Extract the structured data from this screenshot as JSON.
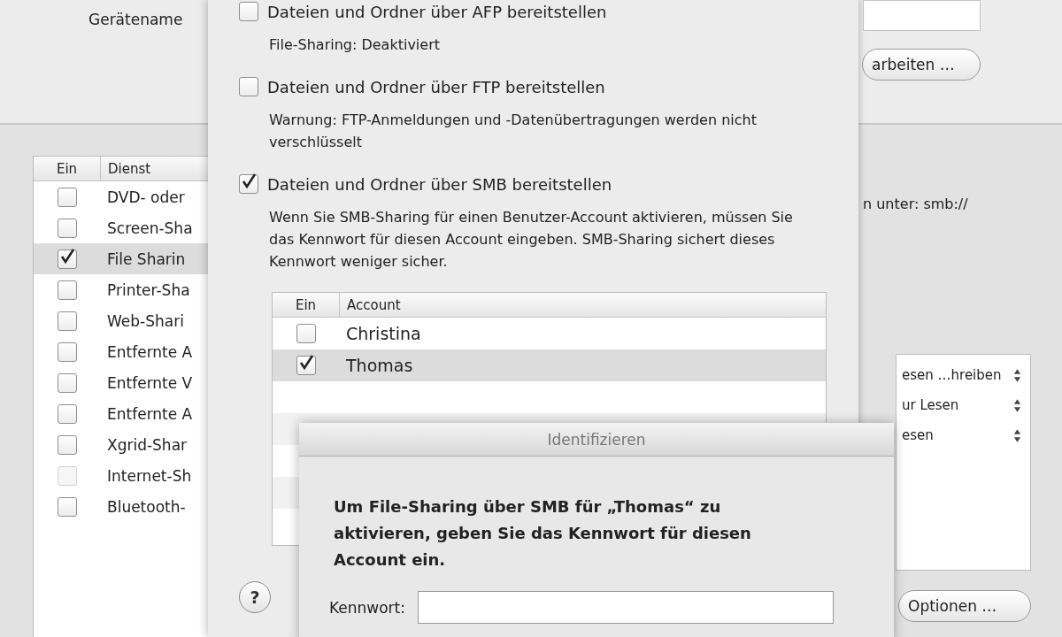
{
  "window": {
    "device_name_label": "Gerätename",
    "edit_button": "arbeiten …",
    "address_text": "n unter: smb://",
    "services": {
      "columns": [
        "Ein",
        "Dienst"
      ],
      "rows": [
        {
          "name": "DVD- oder",
          "checked": false,
          "disabled": false,
          "selected": false
        },
        {
          "name": "Screen-Sha",
          "checked": false,
          "disabled": false,
          "selected": false
        },
        {
          "name": "File Sharin",
          "checked": true,
          "disabled": false,
          "selected": true
        },
        {
          "name": "Printer-Sha",
          "checked": false,
          "disabled": false,
          "selected": false
        },
        {
          "name": "Web-Shari",
          "checked": false,
          "disabled": false,
          "selected": false
        },
        {
          "name": "Entfernte A",
          "checked": false,
          "disabled": false,
          "selected": false
        },
        {
          "name": "Entfernte V",
          "checked": false,
          "disabled": false,
          "selected": false
        },
        {
          "name": "Entfernte A",
          "checked": false,
          "disabled": false,
          "selected": false
        },
        {
          "name": "Xgrid-Shar",
          "checked": false,
          "disabled": false,
          "selected": false
        },
        {
          "name": "Internet-Sh",
          "checked": false,
          "disabled": true,
          "selected": false
        },
        {
          "name": "Bluetooth-",
          "checked": false,
          "disabled": false,
          "selected": false
        }
      ]
    },
    "permissions": [
      {
        "text": "esen …hreiben"
      },
      {
        "text": "ur Lesen"
      },
      {
        "text": "esen"
      }
    ],
    "options_button": "Optionen …"
  },
  "sharing_sheet": {
    "options": [
      {
        "label": "Dateien und Ordner über AFP bereitstellen",
        "checked": false,
        "note": "File-Sharing: Deaktiviert"
      },
      {
        "label": "Dateien und Ordner über FTP bereitstellen",
        "checked": false,
        "note": "Warnung: FTP-Anmeldungen und -Datenübertragungen werden nicht verschlüsselt"
      },
      {
        "label": "Dateien und Ordner über SMB bereitstellen",
        "checked": true,
        "note": "Wenn Sie SMB-Sharing für einen Benutzer-Account aktivieren, müssen Sie das Kennwort für diesen Account eingeben. SMB-Sharing sichert dieses Kennwort weniger sicher."
      }
    ],
    "accounts": {
      "columns": [
        "Ein",
        "Account"
      ],
      "rows": [
        {
          "name": "Christina",
          "checked": false,
          "selected": false
        },
        {
          "name": "Thomas",
          "checked": true,
          "selected": true
        }
      ]
    },
    "help_button": "?"
  },
  "auth_dialog": {
    "title": "Identifizieren",
    "message": "Um File-Sharing über SMB für „Thomas“ zu aktivieren, geben Sie das Kennwort für diesen Account ein.",
    "password_label": "Kennwort:"
  }
}
